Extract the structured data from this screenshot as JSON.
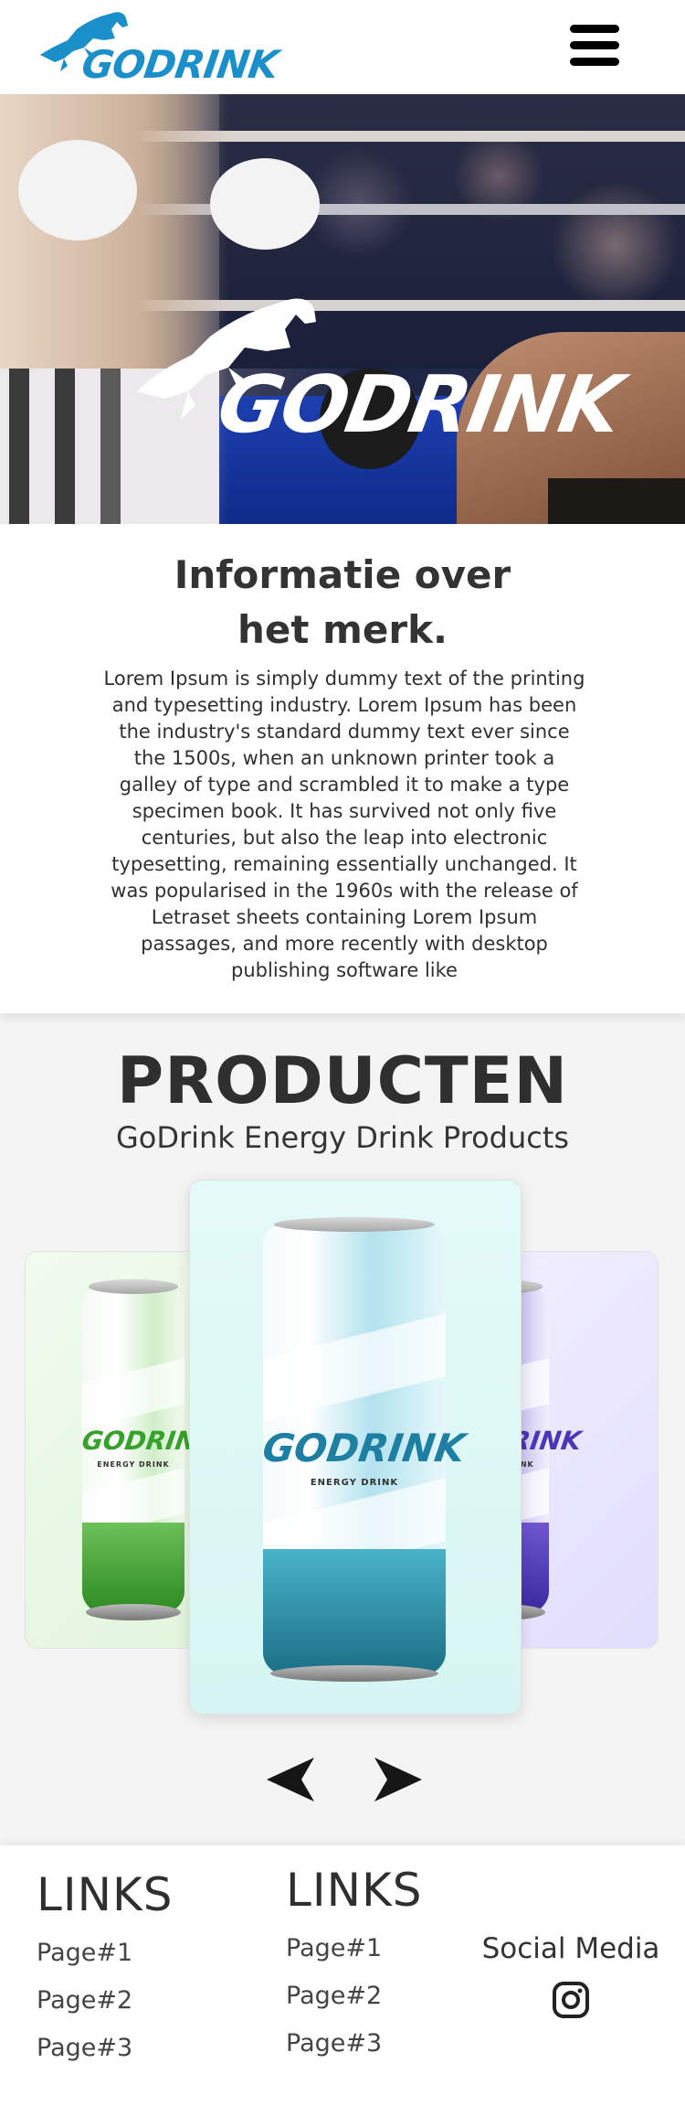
{
  "header": {
    "logo_text": "GODRINK",
    "menu_icon": "hamburger-menu-icon"
  },
  "hero": {
    "logo_text": "GODRINK"
  },
  "info": {
    "title_line1": "Informatie over",
    "title_line2": "het merk.",
    "body": "Lorem Ipsum is simply dummy text of the printing and typesetting industry. Lorem Ipsum has been the industry's standard dummy text ever since the 1500s, when an unknown printer took a galley of type and scrambled it to make a type specimen book. It has survived not only five centuries, but also the leap into electronic typesetting, remaining essentially unchanged. It was popularised in the 1960s with the release of Letraset sheets containing Lorem Ipsum passages, and more recently with desktop publishing software like"
  },
  "products": {
    "title": "PRODUCTEN",
    "subtitle": "GoDrink Energy Drink Products",
    "items": [
      {
        "brand": "GODRINK",
        "tag": "ENERGY DRINK",
        "color": "#36a12b"
      },
      {
        "brand": "GODRINK",
        "tag": "ENERGY DRINK",
        "color": "#1e7fa2"
      },
      {
        "brand": "GODRINK",
        "tag": "ENERGY DRINK",
        "color": "#4b36b7"
      }
    ],
    "prev_icon": "arrow-left-icon",
    "next_icon": "arrow-right-icon"
  },
  "footer": {
    "col1": {
      "title": "LINKS",
      "links": [
        "Page#1",
        "Page#2",
        "Page#3"
      ]
    },
    "col2": {
      "title": "LINKS",
      "links": [
        "Page#1",
        "Page#2",
        "Page#3"
      ]
    },
    "social": {
      "label": "Social Media",
      "icon": "instagram-icon"
    }
  },
  "colors": {
    "brand_blue": "#1a8fc9",
    "text_dark": "#2f2f2f",
    "page_bg": "#f4f4f4"
  }
}
